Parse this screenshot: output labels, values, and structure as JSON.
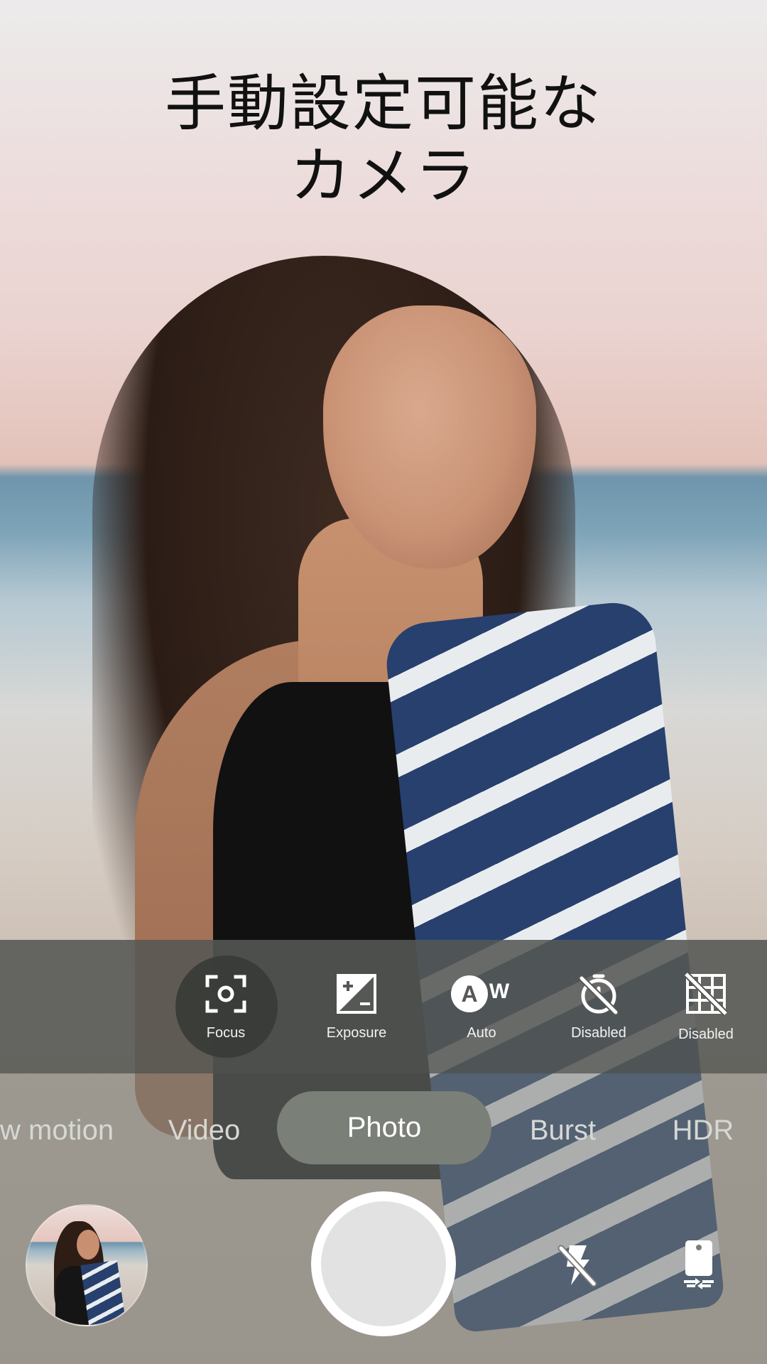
{
  "title": {
    "line1": "手動設定可能な",
    "line2": "カメラ"
  },
  "settings": [
    {
      "id": "focus",
      "label": "Focus",
      "icon": "focus-icon",
      "active": true
    },
    {
      "id": "exposure",
      "label": "Exposure",
      "icon": "exposure-icon",
      "active": false
    },
    {
      "id": "white-balance",
      "label": "Auto",
      "icon": "white-balance-auto-icon",
      "active": false
    },
    {
      "id": "timer",
      "label": "Disabled",
      "icon": "timer-off-icon",
      "active": false
    },
    {
      "id": "grid",
      "label": "Disabled",
      "icon": "grid-off-icon",
      "active": false
    }
  ],
  "modes": [
    {
      "label": "w motion",
      "selected": false
    },
    {
      "label": "Video",
      "selected": false
    },
    {
      "label": "Photo",
      "selected": true
    },
    {
      "label": "Burst",
      "selected": false
    },
    {
      "label": "HDR",
      "selected": false
    }
  ],
  "bottom": {
    "thumbnail": "last-photo-thumbnail",
    "shutter": "shutter-button",
    "flash_icon": "flash-off-icon",
    "switch_icon": "switch-camera-icon"
  },
  "colors": {
    "settings_bar": "#555854",
    "mode_selected": "#7a7f78",
    "shutter_ring": "#ffffff",
    "shutter_fill": "#e2e2e2"
  }
}
